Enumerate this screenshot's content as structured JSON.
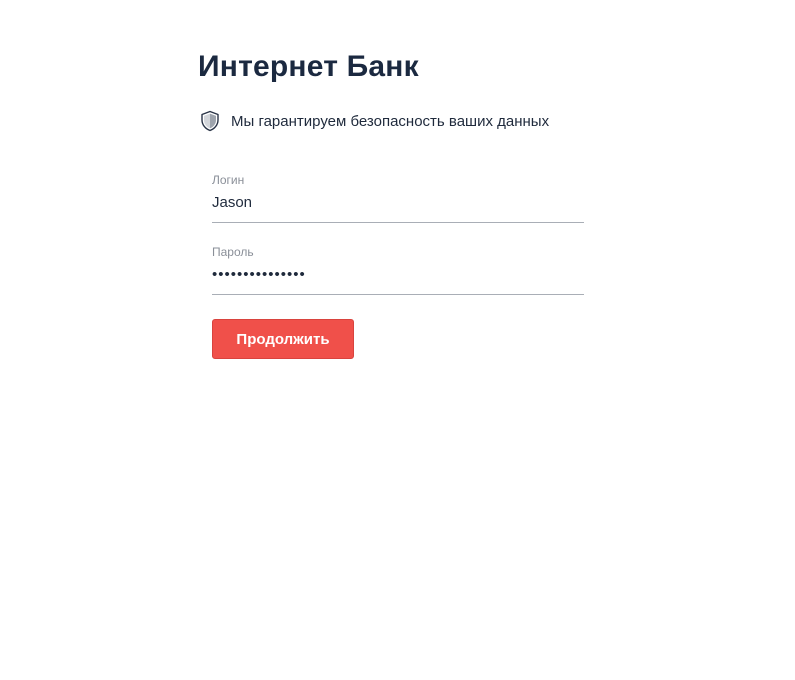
{
  "header": {
    "title": "Интернет Банк"
  },
  "security_note": {
    "icon": "shield-icon",
    "text": "Мы гарантируем безопасность ваших данных"
  },
  "login_form": {
    "login": {
      "label": "Логин",
      "value": "Jason"
    },
    "password": {
      "label": "Пароль",
      "masked_value": "•••••••••••••••"
    },
    "continue_label": "Продолжить"
  },
  "colors": {
    "accent": "#f0504a",
    "title": "#1b2940",
    "label": "#8a8f98",
    "underline": "#a9aeb6"
  }
}
